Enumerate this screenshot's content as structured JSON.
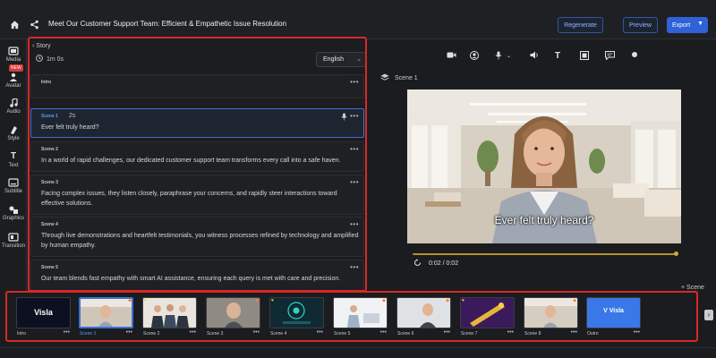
{
  "header": {
    "title": "Meet Our Customer Support Team: Efficient & Empathetic Issue Resolution",
    "regenerate_label": "Regenerate",
    "preview_label": "Preview",
    "export_label": "Export",
    "icons": [
      "home-icon",
      "share-icon"
    ]
  },
  "rail": {
    "new_badge": "NEW",
    "items": [
      {
        "label": "Media",
        "icon": "media-icon"
      },
      {
        "label": "Avatar",
        "icon": "avatar-icon"
      },
      {
        "label": "Audio",
        "icon": "audio-icon"
      },
      {
        "label": "Style",
        "icon": "style-icon"
      },
      {
        "label": "Text",
        "icon": "text-icon"
      },
      {
        "label": "Subtitle",
        "icon": "subtitle-icon"
      },
      {
        "label": "Graphics",
        "icon": "graphics-icon"
      },
      {
        "label": "Transition",
        "icon": "transition-icon"
      }
    ]
  },
  "story": {
    "back_label": "Story",
    "duration": "1m 0s",
    "language": "English",
    "scenes": [
      {
        "label": "Intro",
        "duration": "",
        "text": ""
      },
      {
        "label": "Scene 1",
        "duration": "2s",
        "text": "Ever felt truly heard?"
      },
      {
        "label": "Scene 2",
        "duration": "",
        "text": "In a world of rapid challenges, our dedicated customer support team transforms every call into a safe haven."
      },
      {
        "label": "Scene 3",
        "duration": "",
        "text": "Facing complex issues, they listen closely, paraphrase your concerns, and rapidly steer interactions toward effective solutions."
      },
      {
        "label": "Scene 4",
        "duration": "",
        "text": "Through live demonstrations and heartfelt testimonials, you witness processes refined by technology and amplified by human empathy."
      },
      {
        "label": "Scene 5",
        "duration": "",
        "text": "Our team blends fast empathy with smart AI assistance, ensuring each query is met with care and precision."
      }
    ]
  },
  "preview": {
    "scene_label": "Scene 1",
    "subtitle": "Ever felt truly heard?",
    "timecode": "0:02 / 0:02",
    "progress": 1.0,
    "add_scene_label": "+ Scene"
  },
  "strip": {
    "thumbs": [
      {
        "label": "Intro",
        "brand": "Visla"
      },
      {
        "label": "Scene 1"
      },
      {
        "label": "Scene 2"
      },
      {
        "label": "Scene 3"
      },
      {
        "label": "Scene 4"
      },
      {
        "label": "Scene 5"
      },
      {
        "label": "Scene 6"
      },
      {
        "label": "Scene 7"
      },
      {
        "label": "Scene 8"
      },
      {
        "label": "Outro",
        "brand": "Visla"
      }
    ],
    "active_index": 1
  },
  "colors": {
    "accent_blue": "#3a72d8",
    "highlight_red": "#d72828",
    "timeline_gold": "#b68f2f"
  }
}
